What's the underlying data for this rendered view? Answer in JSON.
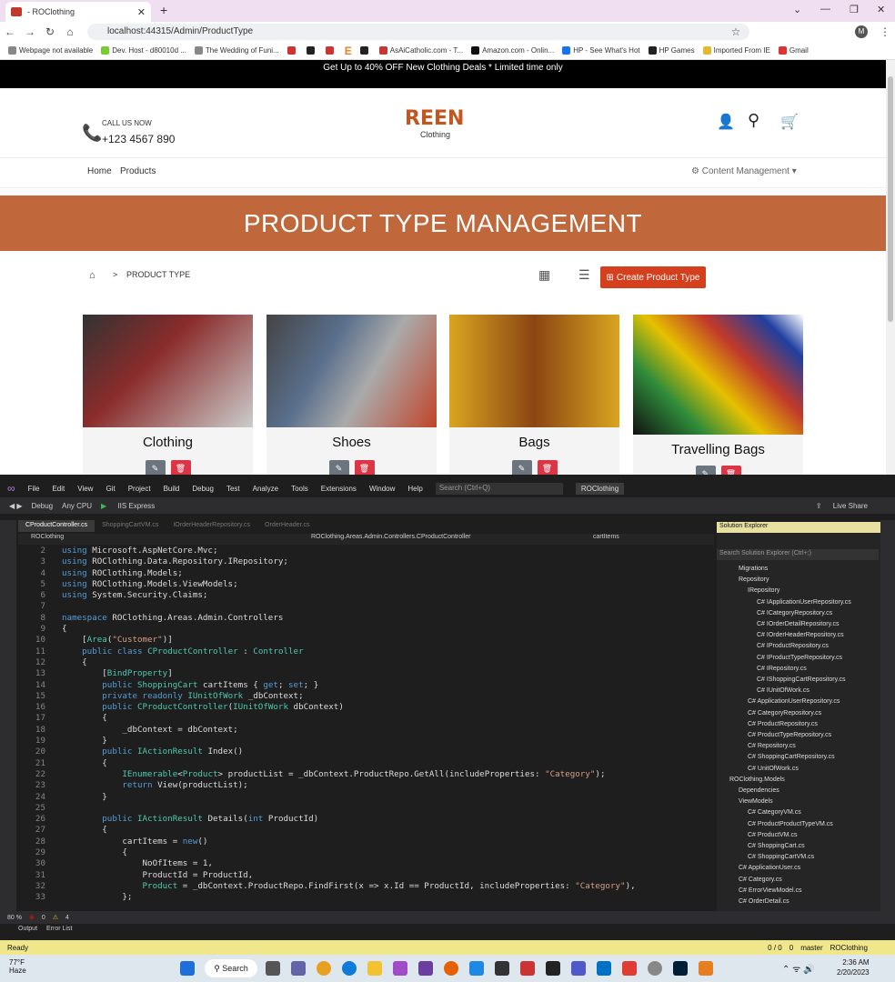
{
  "browser": {
    "tab_title": "- ROClothing",
    "url": "localhost:44315/Admin/ProductType",
    "bookmarks": [
      "Webpage not available",
      "Dev. Host - d80010d ...",
      "The Wedding of Funi...",
      "",
      "",
      "",
      "E",
      "",
      "AsAiCatholic.com - T...",
      "Amazon.com - Onlin...",
      "HP - See What's Hot",
      "HP Games",
      "Imported From IE",
      "Gmail"
    ]
  },
  "site": {
    "promo": "Get Up to 40% OFF New Clothing Deals * Limited time only",
    "call_label": "CALL US NOW",
    "phone": "+123 4567 890",
    "logo": "REEN",
    "logo_sub": "Clothing",
    "nav_home": "Home",
    "nav_products": "Products",
    "content_mgmt": "Content Management",
    "banner": "PRODUCT TYPE MANAGEMENT",
    "crumb": "PRODUCT TYPE",
    "create_btn": "Create Product Type",
    "cards": [
      {
        "name": "Clothing",
        "color": "#8a2b2b"
      },
      {
        "name": "Shoes",
        "color": "#5a6f8c"
      },
      {
        "name": "Bags",
        "color": "#d9a520"
      },
      {
        "name": "Travelling Bags",
        "color": "#2e8b3a"
      }
    ]
  },
  "vs": {
    "menu": [
      "File",
      "Edit",
      "View",
      "Git",
      "Project",
      "Build",
      "Debug",
      "Test",
      "Analyze",
      "Tools",
      "Extensions",
      "Window",
      "Help"
    ],
    "search": "Search (Ctrl+Q)",
    "project": "ROClothing",
    "debug": "Debug",
    "cpu": "Any CPU",
    "run": "IIS Express",
    "live_share": "Live Share",
    "tabs": [
      "CProductController.cs",
      "ShoppingCartVM.cs",
      "IOrderHeaderRepository.cs",
      "OrderHeader.cs"
    ],
    "nav_left": "ROClothing",
    "nav_mid": "ROClothing.Areas.Admin.Controllers.CProductController",
    "nav_right": "cartItems",
    "code": [
      {
        "n": "2",
        "t": "using Microsoft.AspNetCore.Mvc;"
      },
      {
        "n": "3",
        "t": "using ROClothing.Data.Repository.IRepository;"
      },
      {
        "n": "4",
        "t": "using ROClothing.Models;"
      },
      {
        "n": "5",
        "t": "using ROClothing.Models.ViewModels;"
      },
      {
        "n": "6",
        "t": "using System.Security.Claims;"
      },
      {
        "n": "7",
        "t": ""
      },
      {
        "n": "8",
        "t": "namespace ROClothing.Areas.Admin.Controllers"
      },
      {
        "n": "9",
        "t": "{"
      },
      {
        "n": "10",
        "t": "    [Area(\"Customer\")]"
      },
      {
        "n": "11",
        "t": "    public class CProductController : Controller"
      },
      {
        "n": "12",
        "t": "    {"
      },
      {
        "n": "13",
        "t": "        [BindProperty]"
      },
      {
        "n": "14",
        "t": "        public ShoppingCart cartItems { get; set; }"
      },
      {
        "n": "15",
        "t": "        private readonly IUnitOfWork _dbContext;"
      },
      {
        "n": "16",
        "t": "        public CProductController(IUnitOfWork dbContext)"
      },
      {
        "n": "17",
        "t": "        {"
      },
      {
        "n": "18",
        "t": "            _dbContext = dbContext;"
      },
      {
        "n": "19",
        "t": "        }"
      },
      {
        "n": "20",
        "t": "        public IActionResult Index()"
      },
      {
        "n": "21",
        "t": "        {"
      },
      {
        "n": "22",
        "t": "            IEnumerable<Product> productList = _dbContext.ProductRepo.GetAll(includeProperties: \"Category\");"
      },
      {
        "n": "23",
        "t": "            return View(productList);"
      },
      {
        "n": "24",
        "t": "        }"
      },
      {
        "n": "25",
        "t": ""
      },
      {
        "n": "26",
        "t": "        public IActionResult Details(int ProductId)"
      },
      {
        "n": "27",
        "t": "        {"
      },
      {
        "n": "28",
        "t": "            cartItems = new()"
      },
      {
        "n": "29",
        "t": "            {"
      },
      {
        "n": "30",
        "t": "                NoOfItems = 1,"
      },
      {
        "n": "31",
        "t": "                ProductId = ProductId,"
      },
      {
        "n": "32",
        "t": "                Product = _dbContext.ProductRepo.FindFirst(x => x.Id == ProductId, includeProperties: \"Category\"),"
      },
      {
        "n": "33",
        "t": "            };"
      }
    ],
    "se_title": "Solution Explorer",
    "se_search": "Search Solution Explorer (Ctrl+;)",
    "tree": [
      {
        "d": 1,
        "t": "Migrations"
      },
      {
        "d": 1,
        "t": "Repository"
      },
      {
        "d": 2,
        "t": "IRepository"
      },
      {
        "d": 3,
        "t": "C# IApplicationUserRepository.cs"
      },
      {
        "d": 3,
        "t": "C# ICategoryRepository.cs"
      },
      {
        "d": 3,
        "t": "C# IOrderDetailRepository.cs"
      },
      {
        "d": 3,
        "t": "C# IOrderHeaderRepository.cs"
      },
      {
        "d": 3,
        "t": "C# IProductRepository.cs"
      },
      {
        "d": 3,
        "t": "C# IProductTypeRepository.cs"
      },
      {
        "d": 3,
        "t": "C# IRepository.cs"
      },
      {
        "d": 3,
        "t": "C# IShoppingCartRepository.cs"
      },
      {
        "d": 3,
        "t": "C# IUnitOfWork.cs"
      },
      {
        "d": 2,
        "t": "C# ApplicationUserRepository.cs"
      },
      {
        "d": 2,
        "t": "C# CategoryRepository.cs"
      },
      {
        "d": 2,
        "t": "C# ProductRepository.cs"
      },
      {
        "d": 2,
        "t": "C# ProductTypeRepository.cs"
      },
      {
        "d": 2,
        "t": "C# Repository.cs"
      },
      {
        "d": 2,
        "t": "C# ShoppingCartRepository.cs"
      },
      {
        "d": 2,
        "t": "C# UnitOfWork.cs"
      },
      {
        "d": 0,
        "t": "ROClothing.Models"
      },
      {
        "d": 1,
        "t": "Dependencies"
      },
      {
        "d": 1,
        "t": "ViewModels"
      },
      {
        "d": 2,
        "t": "C# CategoryVM.cs"
      },
      {
        "d": 2,
        "t": "C# ProductProductTypeVM.cs"
      },
      {
        "d": 2,
        "t": "C# ProductVM.cs"
      },
      {
        "d": 2,
        "t": "C# ShoppingCart.cs"
      },
      {
        "d": 2,
        "t": "C# ShoppingCartVM.cs"
      },
      {
        "d": 1,
        "t": "C# ApplicationUser.cs"
      },
      {
        "d": 1,
        "t": "C# Category.cs"
      },
      {
        "d": 1,
        "t": "C# ErrorViewModel.cs"
      },
      {
        "d": 1,
        "t": "C# OrderDetail.cs"
      }
    ],
    "zoom": "80 %",
    "errors": "0",
    "warnings": "4",
    "bottom_tabs": [
      "Output",
      "Error List"
    ],
    "ready": "Ready",
    "lines": "0 / 0",
    "pending": "0",
    "branch": "master",
    "repo": "ROClothing"
  },
  "taskbar": {
    "temp": "77°F",
    "weather": "Haze",
    "search": "Search",
    "time": "2:36 AM",
    "date": "2/20/2023"
  }
}
